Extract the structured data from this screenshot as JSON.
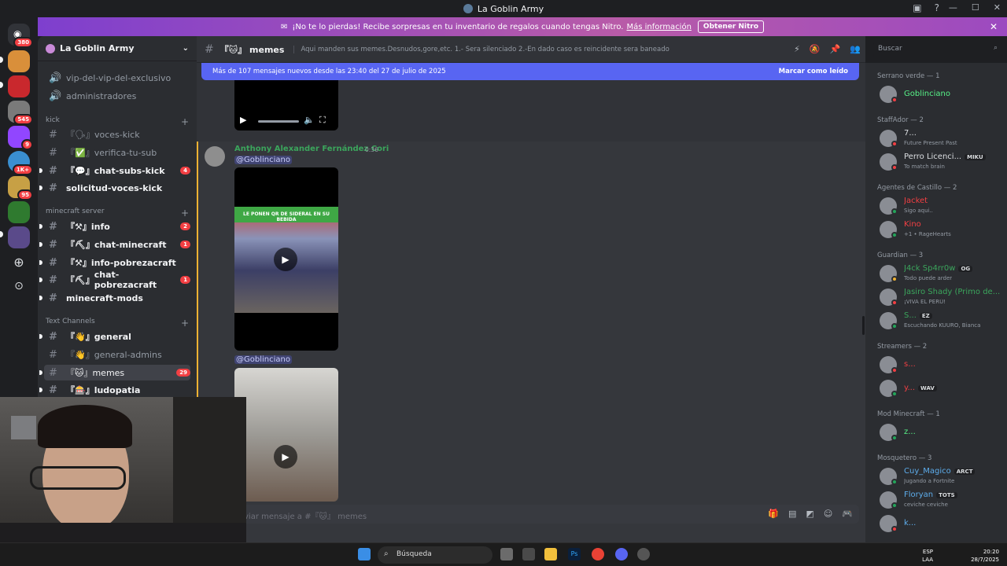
{
  "window": {
    "title": "La Goblin Army"
  },
  "rail": {
    "dm_badge": "380",
    "servers": [
      {
        "badge": ""
      },
      {
        "badge": ""
      },
      {
        "badge": "545"
      },
      {
        "badge": "9"
      },
      {
        "badge": "1K+"
      },
      {
        "badge": "95"
      },
      {
        "badge": ""
      },
      {
        "badge": ""
      }
    ]
  },
  "banner": {
    "text": "¡No te lo pierdas! Recibe sorpresas en tu inventario de regalos cuando tengas Nitro.",
    "link": "Más información",
    "cta": "Obtener Nitro"
  },
  "server": {
    "name": "La Goblin Army"
  },
  "sidebar": {
    "items_top": [
      {
        "name": "vip-del-vip-del-exclusivo"
      },
      {
        "name": "administradores"
      }
    ],
    "cat_kick": "kick",
    "kick": [
      {
        "prefix": "『🗣』",
        "name": "voces-kick",
        "count": ""
      },
      {
        "prefix": "『✅』",
        "name": "verifica-tu-sub",
        "count": ""
      },
      {
        "prefix": "『💬』",
        "name": "chat-subs-kick",
        "count": "4"
      },
      {
        "prefix": "",
        "name": "solicitud-voces-kick",
        "count": ""
      }
    ],
    "cat_mc": "minecraft server",
    "mc": [
      {
        "prefix": "『⚒』",
        "name": "info",
        "count": "2"
      },
      {
        "prefix": "『⛏』",
        "name": "chat-minecraft",
        "count": "1"
      },
      {
        "prefix": "『⚒』",
        "name": "info-pobrezacraft",
        "count": ""
      },
      {
        "prefix": "『⛏』",
        "name": "chat-pobrezacraft",
        "count": "1"
      },
      {
        "prefix": "",
        "name": "minecraft-mods",
        "count": ""
      }
    ],
    "cat_text": "Text Channels",
    "text": [
      {
        "prefix": "『👋』",
        "name": "general",
        "count": ""
      },
      {
        "prefix": "『👋』",
        "name": "general-admins",
        "count": ""
      },
      {
        "prefix": "『🐱』",
        "name": "memes",
        "count": "29"
      },
      {
        "prefix": "『🎰』",
        "name": "ludopatia",
        "count": ""
      }
    ]
  },
  "header": {
    "channel": "『🐱』 memes",
    "topic": "Aqui manden sus memes.Desnudos,gore,etc. 1.- Sera silenciado 2.-En dado caso es reincidente sera baneado"
  },
  "search": {
    "placeholder": "Buscar"
  },
  "newmsg": {
    "text": "Más de 107 mensajes nuevos desde las 23:40 del 27 de julio de 2025",
    "mark": "Marcar como leído"
  },
  "message": {
    "author": "Anthony Alexander Fernández Cori",
    "time": "0:36",
    "mention1": "@Goblinciano",
    "mention2": "@Goblinciano",
    "video1_caption": "LE PONEN QR DE SIDERAL EN SU BEBIDA"
  },
  "composer": {
    "placeholder": "viar mensaje a #『🐱』 memes"
  },
  "members": [
    {
      "group": "Serrano verde — 1",
      "list": [
        {
          "name": "Goblinciano",
          "sub": "",
          "color": "#57f287",
          "status": "#f23f43",
          "tag": ""
        }
      ]
    },
    {
      "group": "StaffAdor — 2",
      "list": [
        {
          "name": "7...",
          "sub": "Future Present Past",
          "color": "#dbdee1",
          "status": "#f23f43",
          "tag": ""
        },
        {
          "name": "Perro Licenci...",
          "sub": "To match brain",
          "color": "#dbdee1",
          "status": "#f23f43",
          "tag": "MIKU"
        }
      ]
    },
    {
      "group": "Agentes de Castillo — 2",
      "list": [
        {
          "name": "Jacket",
          "sub": "Sigo aqui..",
          "color": "#f23f43",
          "status": "#23a55a",
          "tag": ""
        },
        {
          "name": "Kino",
          "sub": "+1 • RageHearts",
          "color": "#f23f43",
          "status": "#23a55a",
          "tag": ""
        }
      ]
    },
    {
      "group": "Guardian — 3",
      "list": [
        {
          "name": "J4ck Sp4rr0w",
          "sub": "Todo puede arder",
          "color": "#3ba55c",
          "status": "#f0b232",
          "tag": "OG"
        },
        {
          "name": "Jasiro Shady (Primo de...",
          "sub": "¡VIVA EL PERÚ!",
          "color": "#3ba55c",
          "status": "#f23f43",
          "tag": ""
        },
        {
          "name": "S...",
          "sub": "Escuchando KUURO, Bianca",
          "color": "#3ba55c",
          "status": "#23a55a",
          "tag": "EZ"
        }
      ]
    },
    {
      "group": "Streamers — 2",
      "list": [
        {
          "name": "s...",
          "sub": "",
          "color": "#f23f43",
          "status": "#f23f43",
          "tag": ""
        },
        {
          "name": "y...",
          "sub": "",
          "color": "#f23f43",
          "status": "#23a55a",
          "tag": "WAV"
        }
      ]
    },
    {
      "group": "Mod Minecraft — 1",
      "list": [
        {
          "name": "z...",
          "sub": "",
          "color": "#57f287",
          "status": "#23a55a",
          "tag": ""
        }
      ]
    },
    {
      "group": "Mosquetero — 3",
      "list": [
        {
          "name": "Cuy_Magico",
          "sub": "Jugando a Fortnite",
          "color": "#5dadec",
          "status": "#23a55a",
          "tag": "ARCT"
        },
        {
          "name": "Floryan",
          "sub": "ceviche ceviche",
          "color": "#5dadec",
          "status": "#23a55a",
          "tag": "TOTS"
        },
        {
          "name": "k...",
          "sub": "",
          "color": "#5dadec",
          "status": "#f23f43",
          "tag": ""
        }
      ]
    }
  ],
  "taskbar": {
    "search": "Búsqueda",
    "lang1": "ESP",
    "lang2": "LAA",
    "time": "20:20",
    "date": "28/7/2025"
  }
}
